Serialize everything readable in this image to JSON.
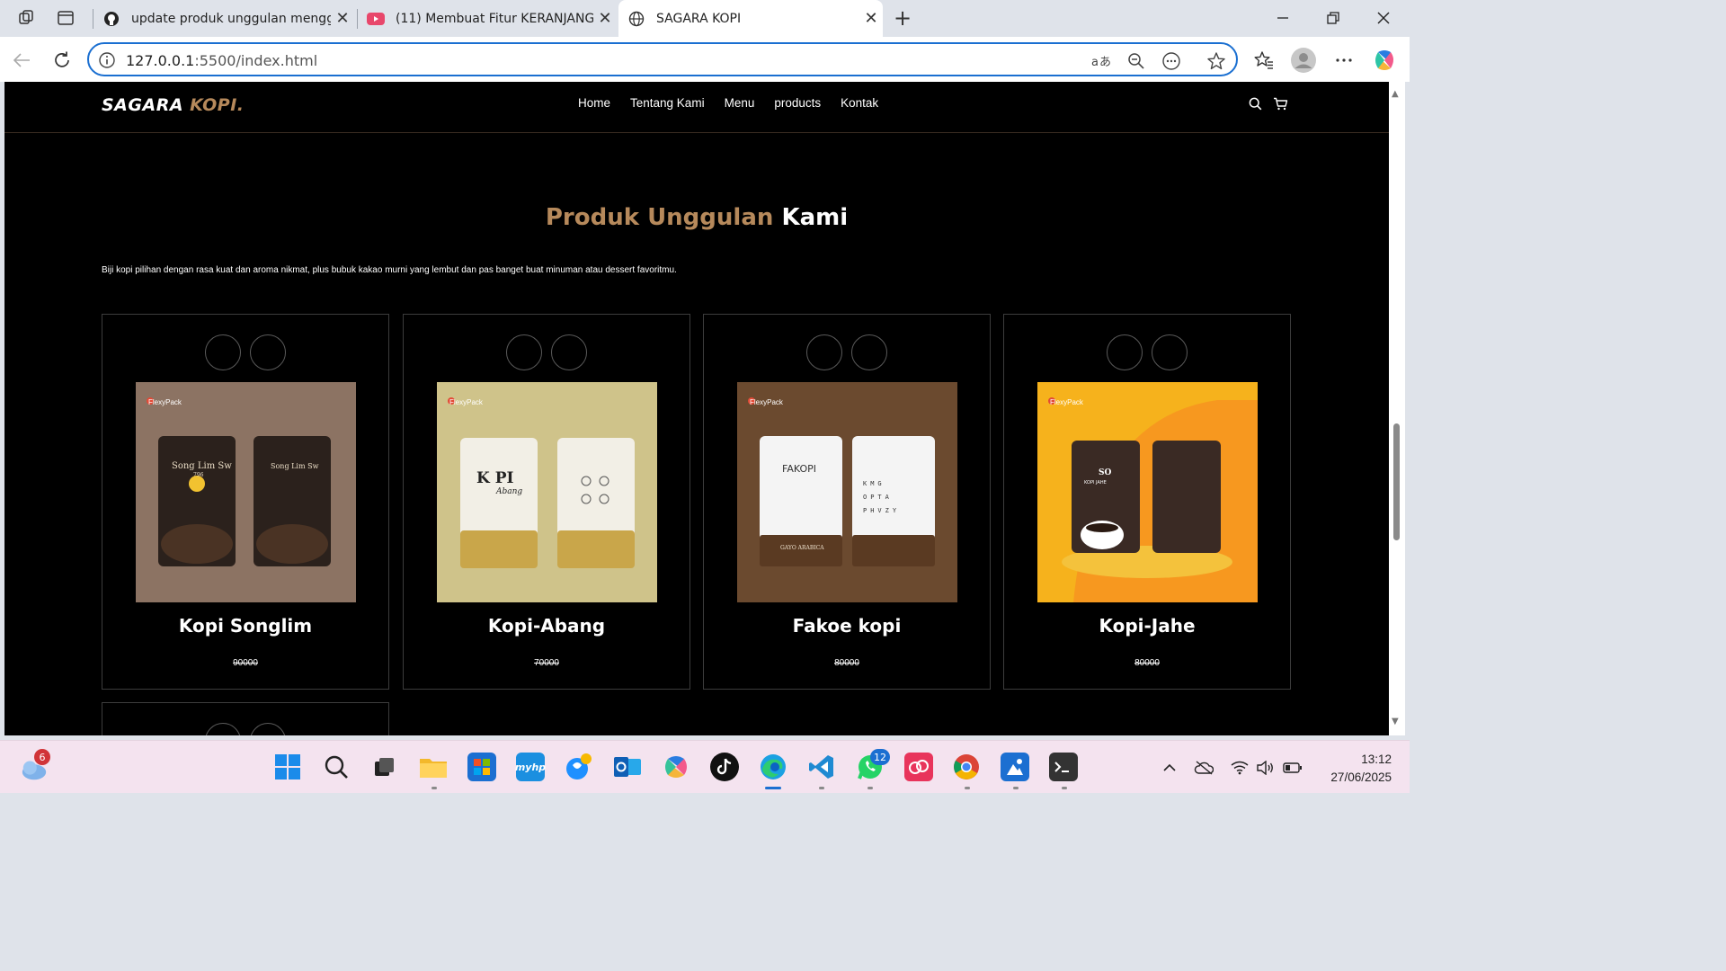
{
  "browser": {
    "tabs": [
      {
        "title": "update produk unggulan menggu",
        "icon": "github-icon"
      },
      {
        "title": "(11) Membuat Fitur KERANJANG I",
        "icon": "youtube-icon"
      },
      {
        "title": "SAGARA KOPI",
        "icon": "globe-icon"
      }
    ],
    "close_glyph": "✕",
    "new_tab_glyph": "+",
    "url_host": "127.0.0.1",
    "url_path": ":5500/index.html"
  },
  "site": {
    "logo_main": "SAGARA ",
    "logo_accent": "KOPI.",
    "nav": [
      "Home",
      "Tentang Kami",
      "Menu",
      "products",
      "Kontak"
    ],
    "title_accent": "Produk Unggulan",
    "title_main": " Kami",
    "description": "Biji kopi pilihan dengan rasa kuat dan aroma nikmat, plus bubuk kakao murni yang lembut dan pas banget buat minuman atau dessert favoritmu.",
    "products": [
      {
        "name": "Kopi Songlim",
        "price": "90000",
        "brand": "FlexyPack",
        "pack_text": "Song Lim Sw",
        "sub_text": "796",
        "bg": "#8c7363"
      },
      {
        "name": "Kopi-Abang",
        "price": "70000",
        "brand": "FlexyPack",
        "pack_text": "K PI",
        "sub_text": "Abang",
        "bg": "#cfc38a"
      },
      {
        "name": "Fakoe kopi",
        "price": "80000",
        "brand": "FlexyPack",
        "pack_text": "FAKOPI",
        "sub_text": "GAYO ARABICA",
        "bg": "#6b4a2f"
      },
      {
        "name": "Kopi-Jahe",
        "price": "80000",
        "brand": "FlexyPack",
        "pack_text": "SO",
        "sub_text": "KOPI JAHE",
        "bg": "#f6b21c"
      }
    ]
  },
  "taskbar": {
    "weather_badge": "6",
    "whatsapp_badge": "12",
    "myhp_label": "myhp",
    "time": "13:12",
    "date": "27/06/2025"
  },
  "colors": {
    "accent": "#b6895b",
    "focus_blue": "#1a6fd1",
    "page_bg": "#000000"
  }
}
